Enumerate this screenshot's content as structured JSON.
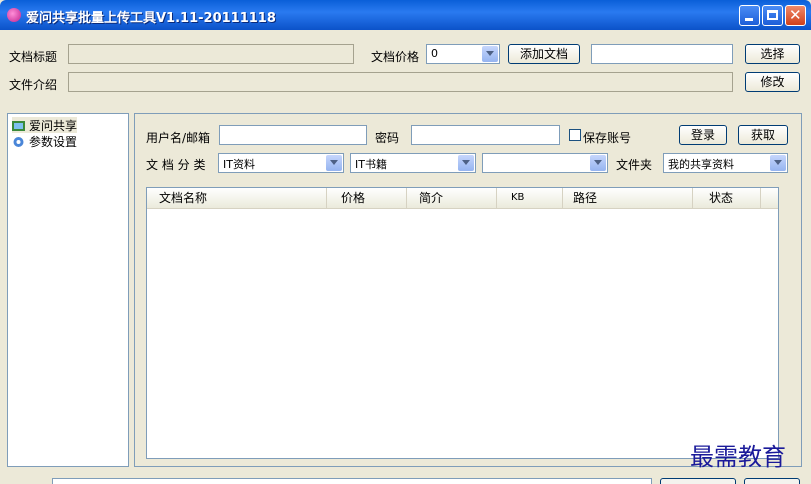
{
  "window": {
    "title": "爱问共享批量上传工具V1.11-20111118",
    "controls": [
      "minimize",
      "maximize",
      "close"
    ],
    "close_glyph": "✕"
  },
  "top_form": {
    "doc_title_label": "文档标题",
    "doc_title_value": "",
    "price_label": "文档价格",
    "price_value": "0",
    "add_doc_button": "添加文档",
    "file_path_value": "",
    "select_button": "选择",
    "intro_label": "文件介绍",
    "intro_value": "",
    "edit_button": "修改"
  },
  "sidebar": {
    "items": [
      {
        "label": "爱问共享",
        "icon": "share-icon",
        "selected": true
      },
      {
        "label": "参数设置",
        "icon": "gear-icon",
        "selected": false
      }
    ]
  },
  "login": {
    "username_label": "用户名/邮箱",
    "username_value": "",
    "password_label": "密码",
    "password_value": "",
    "save_account_label": "保存账号",
    "save_account_checked": false,
    "login_button": "登录",
    "fetch_button": "获取"
  },
  "category": {
    "label": "文 档 分 类",
    "select1": "IT资料",
    "select2": "IT书籍",
    "select3": "",
    "folder_label": "文件夹",
    "folder_value": "我的共享资料"
  },
  "table": {
    "columns": [
      "文档名称",
      "价格",
      "简介",
      "KB",
      "路径",
      "状态"
    ],
    "rows": []
  },
  "watermark": "最需教育",
  "colors": {
    "titlebar": "#0a5fd8",
    "window_bg": "#ece9d8",
    "border": "#7f9db9",
    "watermark": "#1a1a9a"
  }
}
